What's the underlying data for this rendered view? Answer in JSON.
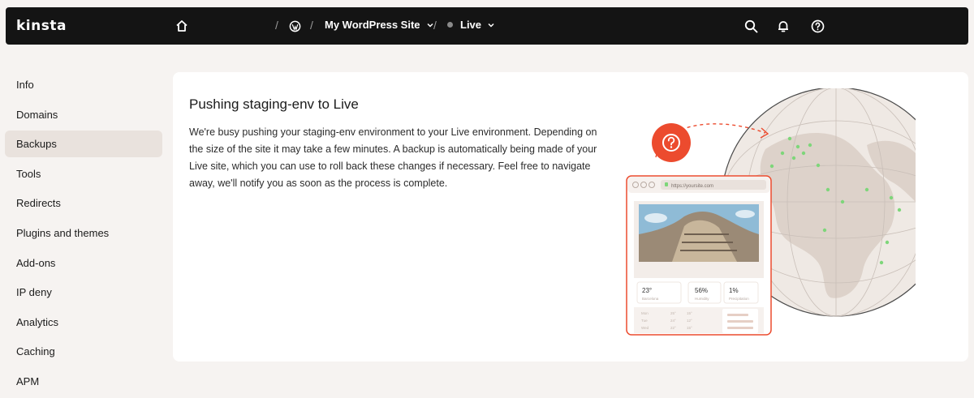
{
  "topbar": {
    "logo": "kinsta",
    "breadcrumb": {
      "site": "My WordPress Site",
      "environment": "Live"
    },
    "icons": [
      "home-icon",
      "wordpress-icon",
      "search-icon",
      "bell-icon",
      "help-icon"
    ]
  },
  "sidebar": {
    "items": [
      {
        "label": "Info",
        "active": false
      },
      {
        "label": "Domains",
        "active": false
      },
      {
        "label": "Backups",
        "active": true
      },
      {
        "label": "Tools",
        "active": false
      },
      {
        "label": "Redirects",
        "active": false
      },
      {
        "label": "Plugins and themes",
        "active": false
      },
      {
        "label": "Add-ons",
        "active": false
      },
      {
        "label": "IP deny",
        "active": false
      },
      {
        "label": "Analytics",
        "active": false
      },
      {
        "label": "Caching",
        "active": false
      },
      {
        "label": "APM",
        "active": false
      }
    ]
  },
  "main": {
    "title": "Pushing staging-env to Live",
    "description": "We're busy pushing your staging-env environment to your Live environment. Depending on the size of the site it may take a few minutes. A backup is automatically being made of your Live site, which you can use to roll back these changes if necessary. Feel free to navigate away, we'll notify you as soon as the process is complete."
  },
  "illustration": {
    "url": "https://yoursite.com",
    "stats": [
      {
        "value": "23°",
        "label": "Barcelona"
      },
      {
        "value": "56%",
        "label": "Humidity"
      },
      {
        "value": "1%",
        "label": "Precipitation"
      }
    ],
    "forecast": [
      {
        "day": "Mon",
        "a": "25°",
        "b": "15°"
      },
      {
        "day": "Tue",
        "a": "24°",
        "b": "12°"
      },
      {
        "day": "Wed",
        "a": "22°",
        "b": "15°"
      },
      {
        "day": "Thu",
        "a": "23°",
        "b": "15°"
      }
    ]
  },
  "colors": {
    "topbar_bg": "#141414",
    "page_bg": "#f6f3f1",
    "accent": "#ec4b2e",
    "active_nav": "#e9e2dd",
    "globe": "#efe9e4",
    "dot_green": "#7ed67a"
  }
}
